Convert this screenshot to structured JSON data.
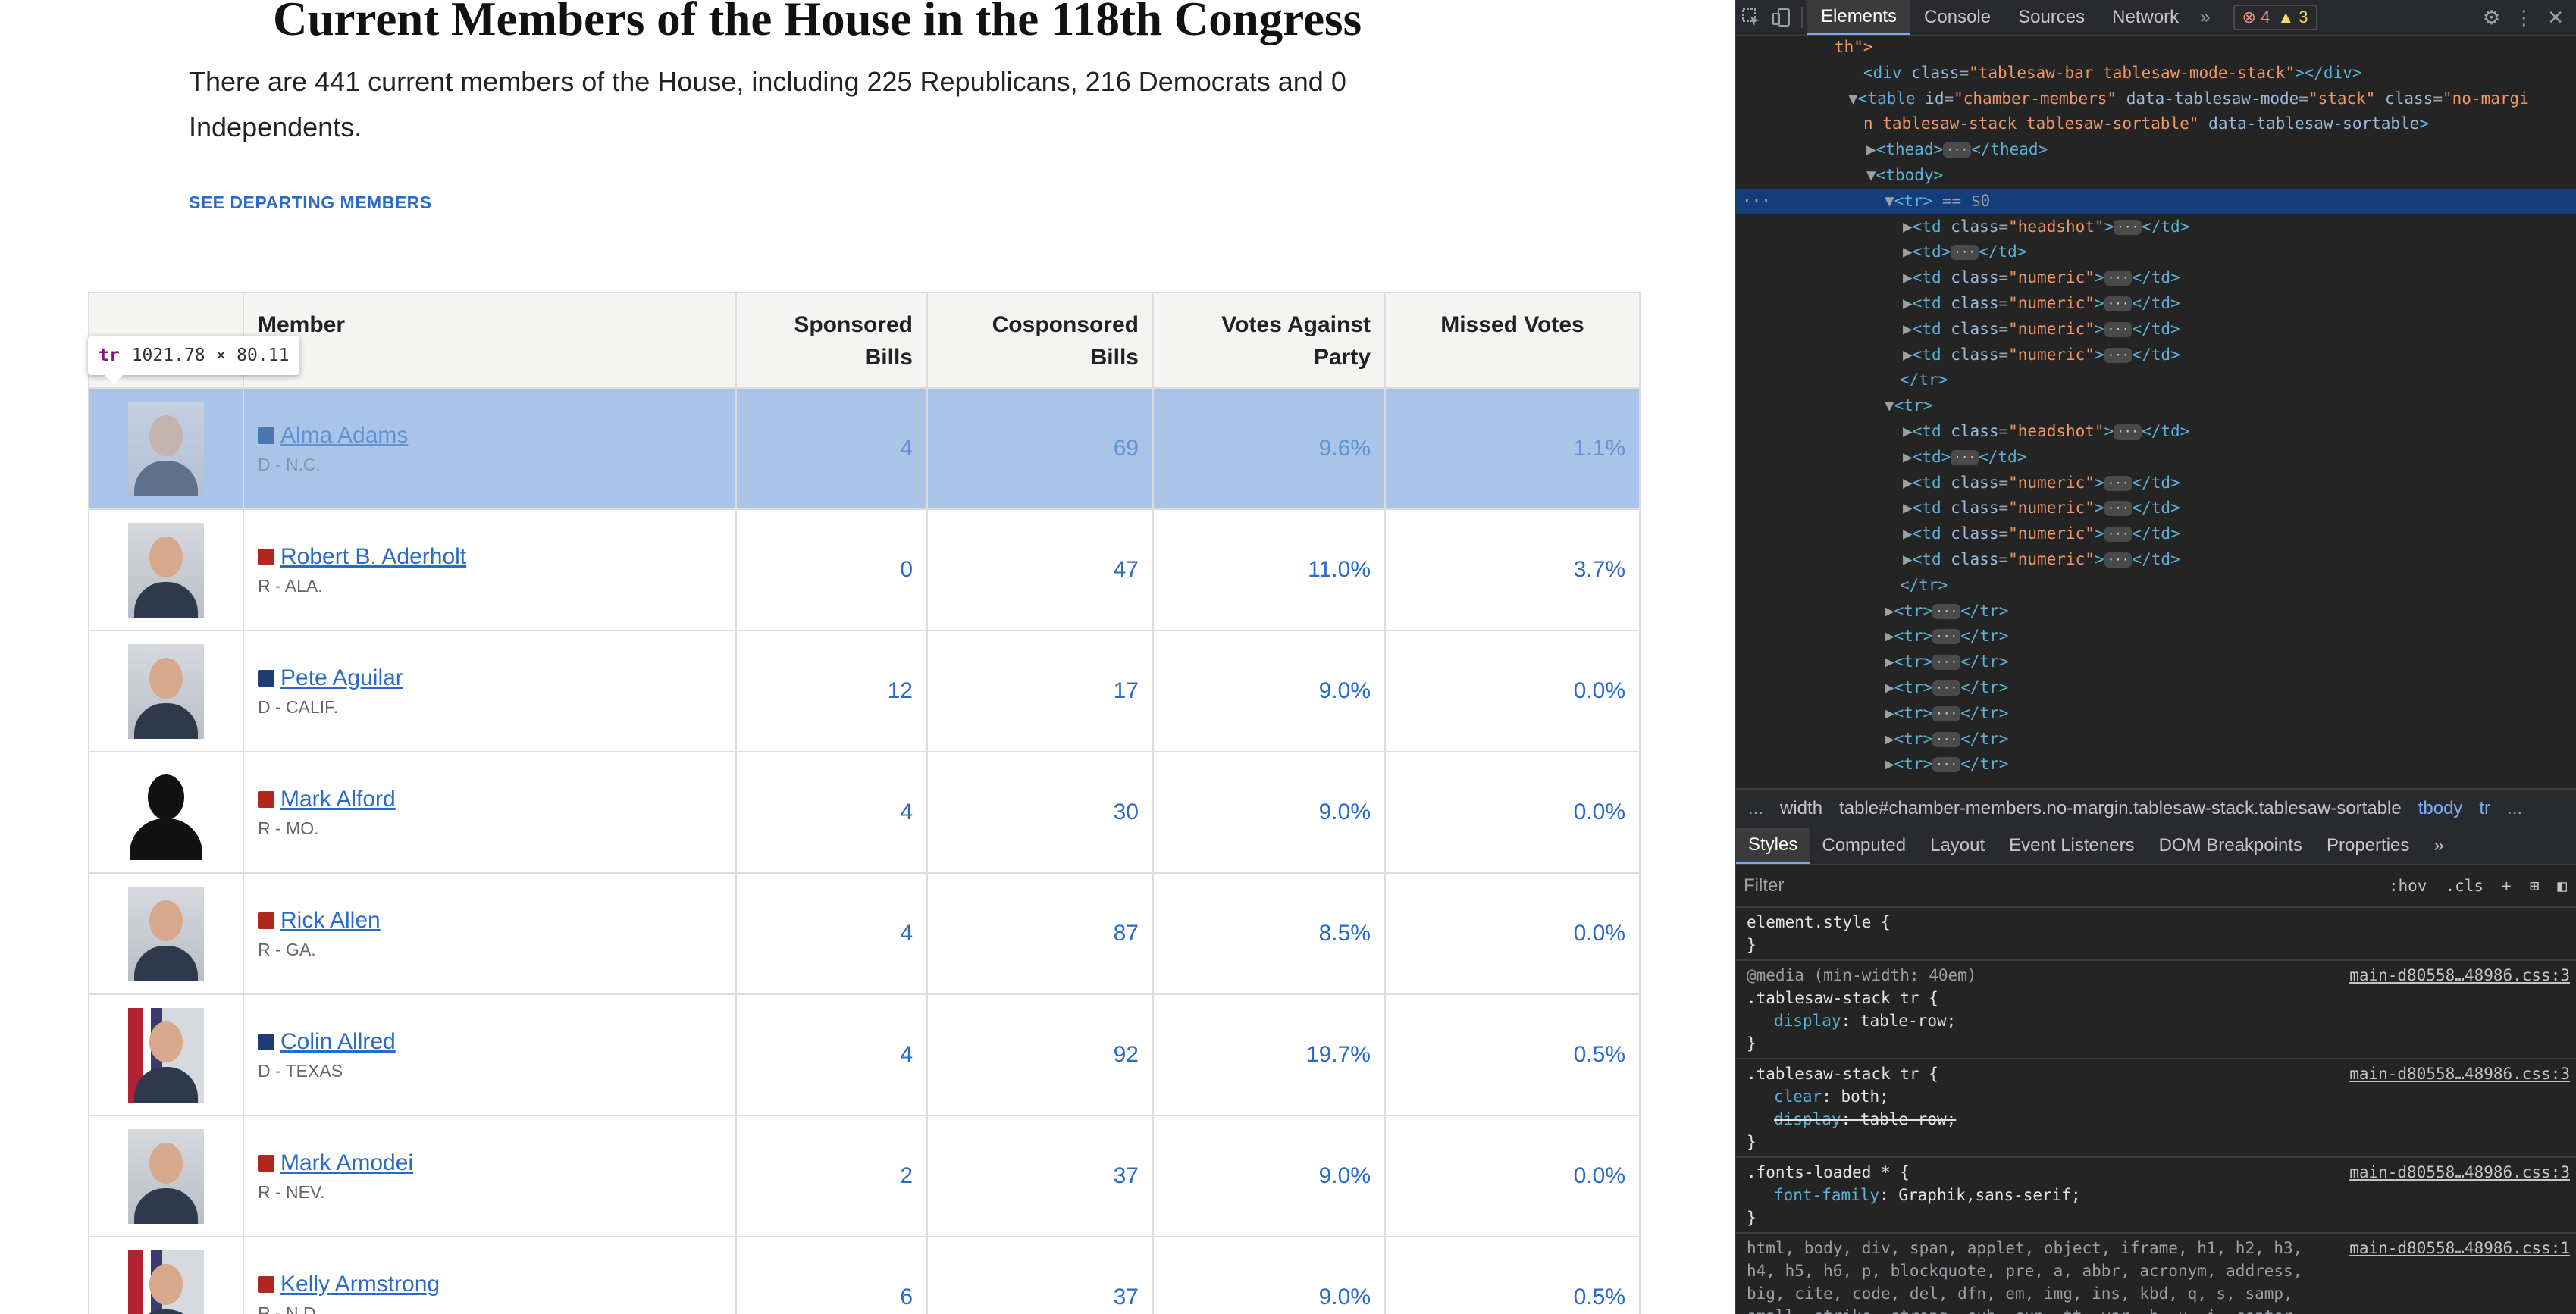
{
  "page": {
    "title": "Current Members of the House in the 118th Congress",
    "intro": "There are 441 current members of the House, including 225 Republicans, 216 Democrats and 0 Independents.",
    "departing_link": "SEE DEPARTING MEMBERS",
    "columns": {
      "member": "Member",
      "sponsored": "Sponsored Bills",
      "cosponsored": "Cosponsored Bills",
      "against_party": "Votes Against Party",
      "missed": "Missed Votes"
    },
    "members": [
      {
        "name": "Alma Adams",
        "sub": "D - N.C.",
        "party": "D",
        "sponsored": "4",
        "cosponsored": "69",
        "against": "9.6%",
        "missed": "1.1%"
      },
      {
        "name": "Robert B. Aderholt",
        "sub": "R - ALA.",
        "party": "R",
        "sponsored": "0",
        "cosponsored": "47",
        "against": "11.0%",
        "missed": "3.7%"
      },
      {
        "name": "Pete Aguilar",
        "sub": "D - CALIF.",
        "party": "D",
        "sponsored": "12",
        "cosponsored": "17",
        "against": "9.0%",
        "missed": "0.0%"
      },
      {
        "name": "Mark Alford",
        "sub": "R - MO.",
        "party": "R",
        "sponsored": "4",
        "cosponsored": "30",
        "against": "9.0%",
        "missed": "0.0%"
      },
      {
        "name": "Rick Allen",
        "sub": "R - GA.",
        "party": "R",
        "sponsored": "4",
        "cosponsored": "87",
        "against": "8.5%",
        "missed": "0.0%"
      },
      {
        "name": "Colin Allred",
        "sub": "D - TEXAS",
        "party": "D",
        "sponsored": "4",
        "cosponsored": "92",
        "against": "19.7%",
        "missed": "0.5%"
      },
      {
        "name": "Mark Amodei",
        "sub": "R - NEV.",
        "party": "R",
        "sponsored": "2",
        "cosponsored": "37",
        "against": "9.0%",
        "missed": "0.0%"
      },
      {
        "name": "Kelly Armstrong",
        "sub": "R - N.D.",
        "party": "R",
        "sponsored": "6",
        "cosponsored": "37",
        "against": "9.0%",
        "missed": "0.5%"
      }
    ],
    "tooltip": {
      "tag": "tr",
      "size": "1021.78 × 80.11"
    },
    "colors": {
      "link": "#2a6ac8",
      "democrat": "#1f3c76",
      "republican": "#b1261e",
      "highlight": "#a9c4e6"
    }
  },
  "devtools": {
    "tabs": [
      "Elements",
      "Console",
      "Sources",
      "Network"
    ],
    "more": "»",
    "issues": {
      "errors": "4",
      "warnings": "3"
    },
    "breadcrumbs": [
      "...",
      "width",
      "table#chamber-members.no-margin.tablesaw-stack.tablesaw-sortable",
      "tbody",
      "tr",
      "..."
    ],
    "styles_tabs": [
      "Styles",
      "Computed",
      "Layout",
      "Event Listeners",
      "DOM Breakpoints",
      "Properties",
      "»"
    ],
    "filter": {
      "placeholder": "Filter",
      "hov": ":hov",
      "cls": ".cls",
      "add": "+"
    },
    "rules": {
      "element_style": "element.style {",
      "media": "@media (min-width: 40em)",
      "r1_sel": ".tablesaw-stack tr {",
      "r1_src": "main-d80558…48986.css:3",
      "r1_p1": "display",
      "r1_v1": "table-row;",
      "r2_sel": ".tablesaw-stack tr {",
      "r2_src": "main-d80558…48986.css:3",
      "r2_p1": "clear",
      "r2_v1": "both;",
      "r2_p2": "display",
      "r2_v2": "table-row;",
      "r3_sel": ".fonts-loaded * {",
      "r3_src": "main-d80558…48986.css:3",
      "r3_p1": "font-family",
      "r3_v1": "Graphik,sans-serif;",
      "r4_src": "main-d80558…48986.css:1",
      "r4_text": "html, body, div, span, applet, object, iframe, h1, h2, h3, h4, h5, h6, p, blockquote, pre, a, abbr, acronym, address, big, cite, code, del, dfn, em, img, ins, kbd, q, s, samp, small, strike, strong, sub, sup, tt, var, b, u, i, center, dl, dt, dd, ol, ul, li, fieldset, form, label, legend, table, caption, tbody, tfoot, thead, tr, th, td, article,",
      "close_brace": "}"
    }
  }
}
